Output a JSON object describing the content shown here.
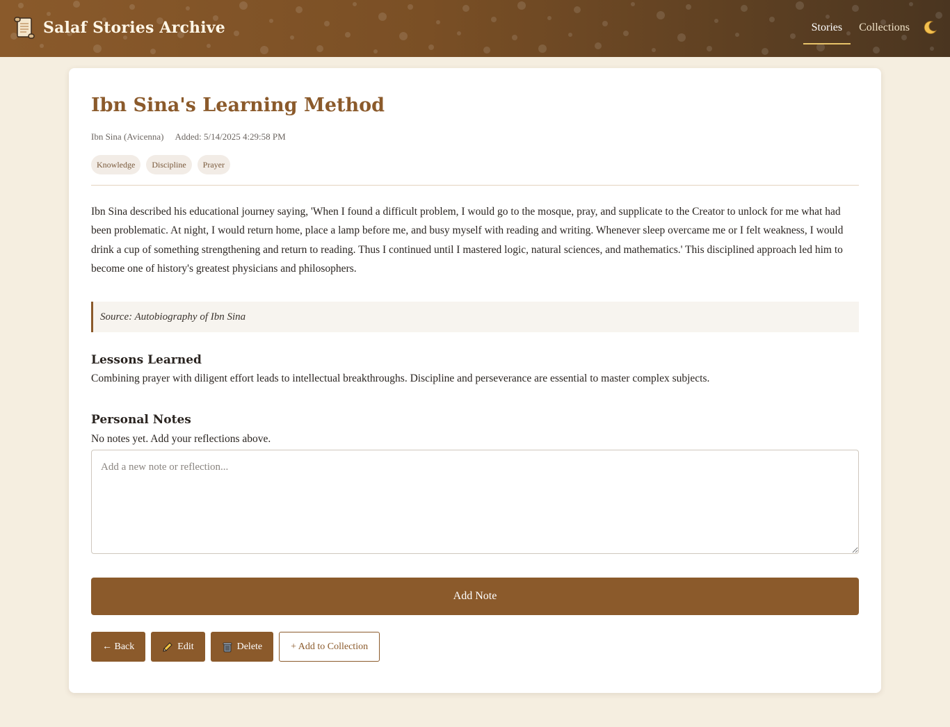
{
  "header": {
    "title": "Salaf Stories Archive",
    "nav": [
      {
        "label": "Stories",
        "active": true
      },
      {
        "label": "Collections",
        "active": false
      }
    ],
    "theme_toggle_icon": "moon-icon",
    "logo_icon": "scroll-icon"
  },
  "story": {
    "title": "Ibn Sina's Learning Method",
    "author": "Ibn Sina (Avicenna)",
    "added": "Added: 5/14/2025 4:29:58 PM",
    "tags": [
      "Knowledge",
      "Discipline",
      "Prayer"
    ],
    "body": "Ibn Sina described his educational journey saying, 'When I found a difficult problem, I would go to the mosque, pray, and supplicate to the Creator to unlock for me what had been problematic. At night, I would return home, place a lamp before me, and busy myself with reading and writing. Whenever sleep overcame me or I felt weakness, I would drink a cup of something strengthening and return to reading. Thus I continued until I mastered logic, natural sciences, and mathematics.' This disciplined approach led him to become one of history's greatest physicians and philosophers.",
    "source": "Source: Autobiography of Ibn Sina",
    "lessons_heading": "Lessons Learned",
    "lessons": "Combining prayer with diligent effort leads to intellectual breakthroughs. Discipline and perseverance are essential to master complex subjects."
  },
  "notes": {
    "heading": "Personal Notes",
    "empty_text": "No notes yet. Add your reflections above.",
    "placeholder": "Add a new note or reflection...",
    "add_label": "Add Note"
  },
  "actions": {
    "back": "← Back",
    "edit": "Edit",
    "delete": "Delete",
    "add_to_collection": "+ Add to Collection"
  },
  "colors": {
    "accent": "#8b5a2b",
    "page_bg": "#f5eee0",
    "header_from": "#8a5a2b",
    "header_to": "#4a3520"
  }
}
